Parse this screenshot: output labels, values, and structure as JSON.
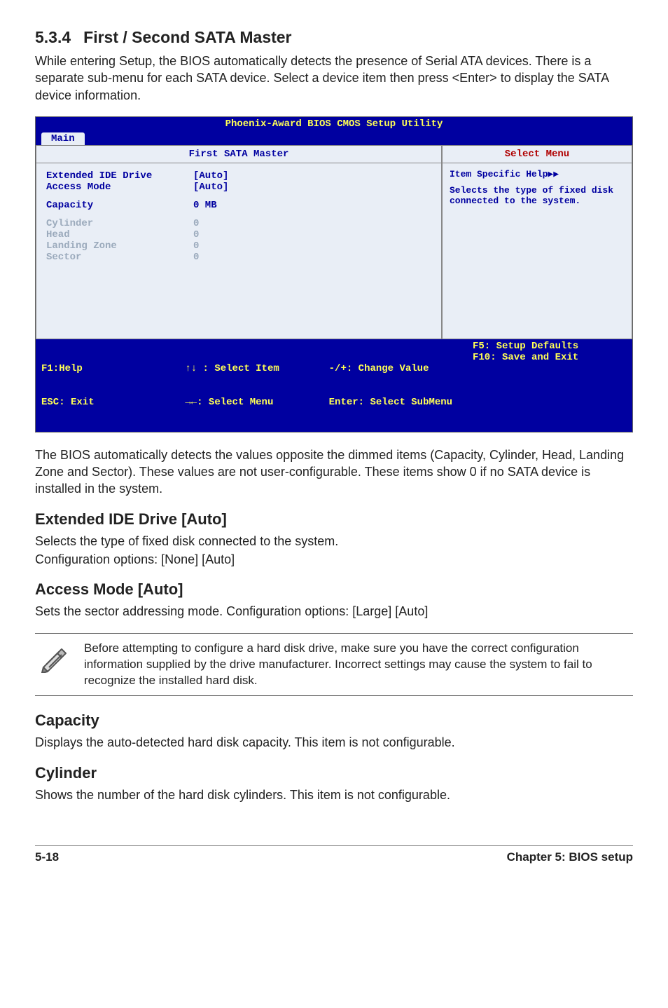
{
  "section": {
    "number": "5.3.4",
    "title": "First / Second SATA Master",
    "intro": "While entering Setup, the BIOS automatically detects the presence of Serial ATA devices. There is a separate sub-menu for each SATA device. Select a device item then press <Enter> to display the SATA device information."
  },
  "bios": {
    "util_title": "Phoenix-Award BIOS CMOS Setup Utility",
    "tab": "Main",
    "panel_title": "First SATA Master",
    "help_title": "Select Menu",
    "rows": {
      "ext_lbl": "Extended IDE Drive",
      "ext_val": "[Auto]",
      "acc_lbl": "Access Mode",
      "acc_val": "[Auto]",
      "cap_lbl": "Capacity",
      "cap_val": "0 MB",
      "cyl_lbl": "Cylinder",
      "cyl_val": "0",
      "head_lbl": "Head",
      "head_val": "0",
      "lz_lbl": "Landing Zone",
      "lz_val": "0",
      "sec_lbl": "Sector",
      "sec_val": "0"
    },
    "help_text_line1": "Item Specific Help▶▶",
    "help_text_rest": "Selects the type of fixed disk connected to the system.",
    "footer": {
      "c1a": "F1:Help",
      "c1b": "ESC: Exit",
      "c2a": "↑↓ : Select Item",
      "c2b": "→←: Select Menu",
      "c3a": "-/+: Change Value",
      "c3b": "Enter: Select SubMenu",
      "c4a": "F5: Setup Defaults",
      "c4b": "F10: Save and Exit"
    }
  },
  "after_bios": "The BIOS automatically detects the values opposite the dimmed items (Capacity, Cylinder,  Head, Landing Zone and Sector). These values are not user-configurable. These items show 0 if no SATA device is installed in the system.",
  "ext_ide": {
    "title": "Extended IDE Drive [Auto]",
    "l1": "Selects the type of fixed disk connected to the system.",
    "l2": "Configuration options: [None] [Auto]"
  },
  "access_mode": {
    "title": "Access Mode [Auto]",
    "l1": "Sets the sector addressing mode. Configuration options: [Large] [Auto]"
  },
  "note": "Before attempting to configure a hard disk drive, make sure you have the correct configuration information supplied by the drive manufacturer. Incorrect settings may cause the system to fail to recognize the installed hard disk.",
  "capacity": {
    "title": "Capacity",
    "l1": "Displays the auto-detected hard disk capacity. This item is not configurable."
  },
  "cylinder": {
    "title": "Cylinder",
    "l1": "Shows the number of the hard disk cylinders. This item is not configurable."
  },
  "footer": {
    "left": "5-18",
    "right": "Chapter 5: BIOS setup"
  }
}
